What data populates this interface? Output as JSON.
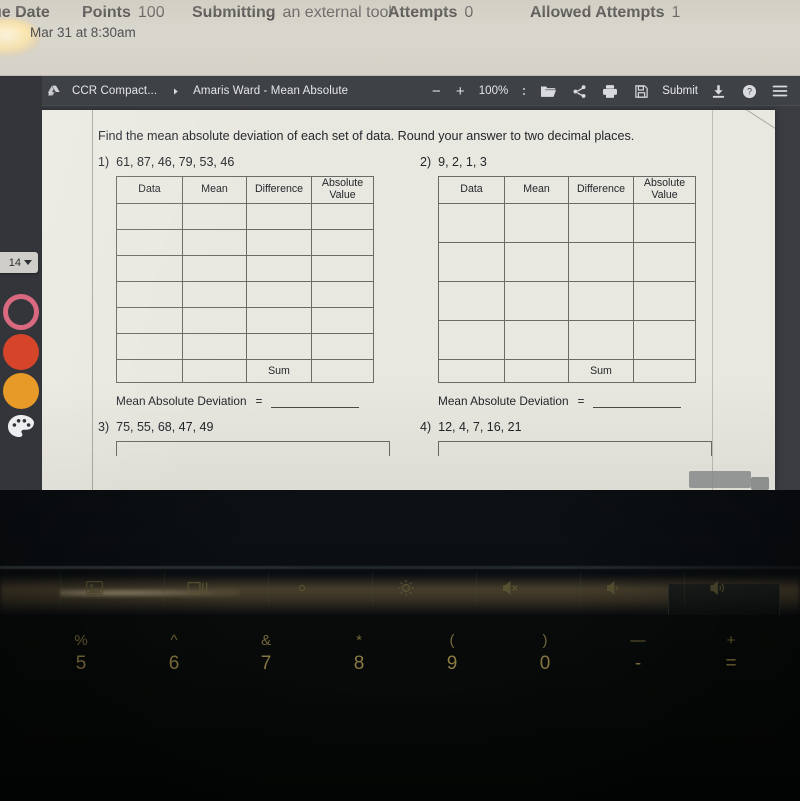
{
  "lms_header": {
    "due_date_label": "ue Date",
    "due_date_value": "Mar 31 at 8:30am",
    "points_label": "Points",
    "points_value": "100",
    "submitting_label": "Submitting",
    "submitting_value": "an external tool",
    "attempts_label": "Attempts",
    "attempts_value": "0",
    "allowed_attempts_label": "Allowed Attempts",
    "allowed_attempts_value": "1"
  },
  "toolbar": {
    "search_icon": "search-icon",
    "drive_icon": "google-drive-icon",
    "folder_name": "CCR Compact...",
    "chevron_icon": "chevron-right-icon",
    "doc_title": "Amaris Ward - Mean Absolute",
    "zoom_out_label": "−",
    "zoom_in_label": "+",
    "zoom_level": "100%",
    "more_icon": "more-vertical-icon",
    "open_icon": "open-folder-icon",
    "share_icon": "share-icon",
    "print_icon": "print-icon",
    "save_icon": "save-disk-icon",
    "submit_label": "Submit",
    "download_icon": "download-icon",
    "help_icon": "help-circle-icon",
    "menu_icon": "hamburger-menu-icon"
  },
  "rail": {
    "size_value": "14",
    "size_caret_icon": "chevron-down-icon",
    "swatch_ring_color": "#d9697f",
    "swatch_red_color": "#d6442a",
    "swatch_orange_color": "#e79a28",
    "palette_icon": "color-palette-icon"
  },
  "worksheet": {
    "instructions": "Find the mean absolute deviation of each set of data. Round your answer to two decimal places.",
    "table_headers": [
      "Data",
      "Mean",
      "Difference",
      "Absolute Value"
    ],
    "sum_label": "Sum",
    "mad_label": "Mean Absolute Deviation",
    "equals": "=",
    "problems": [
      {
        "number": "1)",
        "data": "61, 87, 46, 79, 53, 46",
        "rows": 6
      },
      {
        "number": "2)",
        "data": "9, 2, 1, 3",
        "rows": 4
      },
      {
        "number": "3)",
        "data": "75, 55, 68, 47, 49",
        "rows": 5
      },
      {
        "number": "4)",
        "data": "12, 4, 7, 16, 21",
        "rows": 5
      }
    ]
  },
  "keyboard": {
    "function_keys": [
      "screen-mirror-icon",
      "window-layout-icon",
      "brightness-down-icon",
      "brightness-up-icon",
      "mute-icon",
      "volume-down-icon",
      "volume-up-icon"
    ],
    "number_row": [
      {
        "symbol": "%",
        "digit": "5"
      },
      {
        "symbol": "^",
        "digit": "6"
      },
      {
        "symbol": "&",
        "digit": "7"
      },
      {
        "symbol": "*",
        "digit": "8"
      },
      {
        "symbol": "(",
        "digit": "9"
      },
      {
        "symbol": ")",
        "digit": "0"
      },
      {
        "symbol": "—",
        "digit": "-"
      },
      {
        "symbol": "+",
        "digit": "="
      }
    ]
  }
}
